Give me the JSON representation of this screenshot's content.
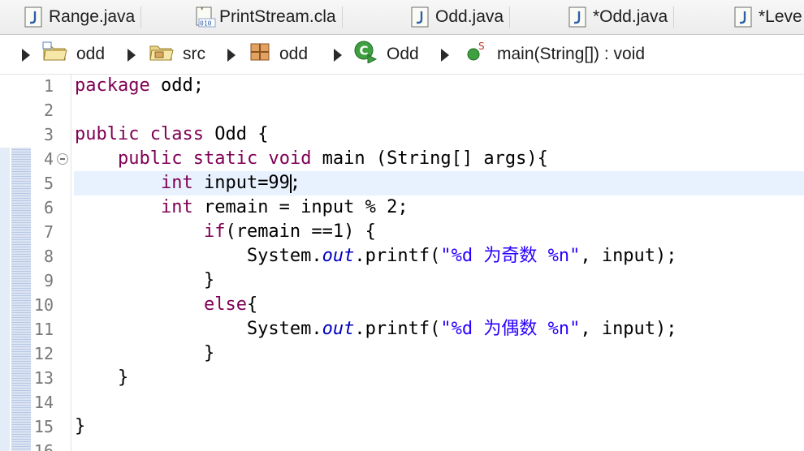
{
  "tabs": [
    {
      "label": "Range.java",
      "icon": "java-file-icon"
    },
    {
      "label": "PrintStream.cla",
      "icon": "class-file-icon"
    },
    {
      "label": "Odd.java",
      "icon": "java-file-icon"
    },
    {
      "label": "*Odd.java",
      "icon": "java-file-icon"
    },
    {
      "label": "*Leve",
      "icon": "java-file-icon"
    }
  ],
  "breadcrumb": [
    {
      "label": "odd",
      "icon": "project-folder-icon"
    },
    {
      "label": "src",
      "icon": "source-folder-icon"
    },
    {
      "label": "odd",
      "icon": "package-icon"
    },
    {
      "label": "Odd",
      "icon": "class-icon"
    },
    {
      "label": "main(String[]) : void",
      "icon": "static-method-icon"
    }
  ],
  "editor": {
    "current_line": 5,
    "cursor_after": "99",
    "fold_marker_line": 4,
    "lines": [
      {
        "n": "1",
        "tokens": [
          {
            "t": "package",
            "k": "kw"
          },
          {
            "t": " odd;"
          }
        ]
      },
      {
        "n": "2",
        "tokens": []
      },
      {
        "n": "3",
        "tokens": [
          {
            "t": "public",
            "k": "kw"
          },
          {
            "t": " "
          },
          {
            "t": "class",
            "k": "kw"
          },
          {
            "t": " Odd {"
          }
        ]
      },
      {
        "n": "4",
        "tokens": [
          {
            "t": "    "
          },
          {
            "t": "public",
            "k": "kw"
          },
          {
            "t": " "
          },
          {
            "t": "static",
            "k": "kw"
          },
          {
            "t": " "
          },
          {
            "t": "void",
            "k": "kw"
          },
          {
            "t": " main (String[] args){"
          }
        ]
      },
      {
        "n": "5",
        "tokens": [
          {
            "t": "        "
          },
          {
            "t": "int",
            "k": "kw"
          },
          {
            "t": " input=99;"
          }
        ]
      },
      {
        "n": "6",
        "tokens": [
          {
            "t": "        "
          },
          {
            "t": "int",
            "k": "kw"
          },
          {
            "t": " remain = input % 2;"
          }
        ]
      },
      {
        "n": "7",
        "tokens": [
          {
            "t": "            "
          },
          {
            "t": "if",
            "k": "kw"
          },
          {
            "t": "(remain ==1) {"
          }
        ]
      },
      {
        "n": "8",
        "tokens": [
          {
            "t": "                System."
          },
          {
            "t": "out",
            "k": "fld"
          },
          {
            "t": ".printf("
          },
          {
            "t": "\"%d 为奇数 %n\"",
            "k": "str"
          },
          {
            "t": ", input);"
          }
        ]
      },
      {
        "n": "9",
        "tokens": [
          {
            "t": "            }"
          }
        ]
      },
      {
        "n": "10",
        "tokens": [
          {
            "t": "            "
          },
          {
            "t": "else",
            "k": "kw"
          },
          {
            "t": "{"
          }
        ]
      },
      {
        "n": "11",
        "tokens": [
          {
            "t": "                System."
          },
          {
            "t": "out",
            "k": "fld"
          },
          {
            "t": ".printf("
          },
          {
            "t": "\"%d 为偶数 %n\"",
            "k": "str"
          },
          {
            "t": ", input);"
          }
        ]
      },
      {
        "n": "12",
        "tokens": [
          {
            "t": "            }"
          }
        ]
      },
      {
        "n": "13",
        "tokens": [
          {
            "t": "    }"
          }
        ]
      },
      {
        "n": "14",
        "tokens": []
      },
      {
        "n": "15",
        "tokens": [
          {
            "t": "}"
          }
        ]
      },
      {
        "n": "16",
        "tokens": []
      }
    ]
  },
  "colors": {
    "keyword": "#7f0055",
    "string": "#2a00ff",
    "static_field": "#0000c0",
    "current_line_bg": "#e8f2fe",
    "line_number": "#787878"
  }
}
